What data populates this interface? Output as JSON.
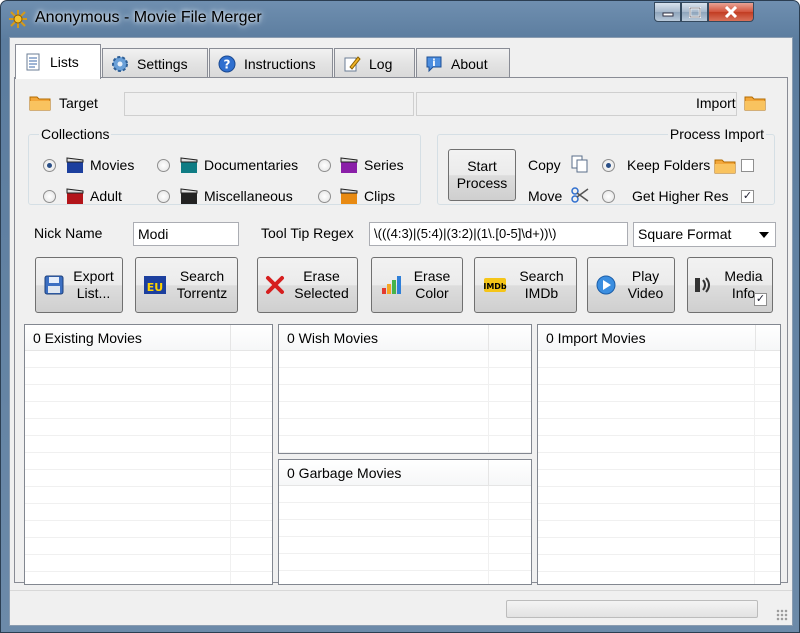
{
  "window": {
    "title": "Anonymous - Movie File Merger"
  },
  "tabs": [
    {
      "label": "Lists",
      "icon": "document-icon",
      "active": true
    },
    {
      "label": "Settings",
      "icon": "gear-icon",
      "active": false
    },
    {
      "label": "Instructions",
      "icon": "help-icon",
      "active": false
    },
    {
      "label": "Log",
      "icon": "pencil-note-icon",
      "active": false
    },
    {
      "label": "About",
      "icon": "info-icon",
      "active": false
    }
  ],
  "target": {
    "label": "Target",
    "value": ""
  },
  "import": {
    "label": "Import",
    "value": ""
  },
  "collections": {
    "title": "Collections",
    "options": [
      "Movies",
      "Documentaries",
      "Series",
      "Adult",
      "Miscellaneous",
      "Clips"
    ],
    "selected": "Movies"
  },
  "process_import": {
    "title": "Process Import",
    "start_button": "Start Process",
    "copy_label": "Copy",
    "move_label": "Move",
    "keep_folders_label": "Keep Folders",
    "keep_folders_checked": false,
    "higher_res_label": "Get Higher Res",
    "higher_res_checked": true,
    "mode_selected": "Copy"
  },
  "nick": {
    "label": "Nick Name",
    "value": "Modi"
  },
  "regex": {
    "label": "Tool Tip Regex",
    "value": "\\(((4:3)|(5:4)|(3:2)|(1\\.[0-5]\\d+))\\)"
  },
  "format_select": {
    "value": "Square Format"
  },
  "actions": [
    {
      "line1": "Export",
      "line2": "List..."
    },
    {
      "line1": "Search",
      "line2": "Torrentz"
    },
    {
      "line1": "Erase",
      "line2": "Selected"
    },
    {
      "line1": "Erase",
      "line2": "Color"
    },
    {
      "line1": "Search",
      "line2": "IMDb"
    },
    {
      "line1": "Play",
      "line2": "Video"
    },
    {
      "line1": "Media",
      "line2": "Info",
      "checked": true
    }
  ],
  "lists": {
    "existing": "0 Existing Movies",
    "wish": "0 Wish Movies",
    "garbage": "0 Garbage Movies",
    "import": "0 Import Movies"
  },
  "status": {
    "progress": 0
  },
  "colors": {
    "accent": "#2a4f87",
    "title_bar": "#6f8fb0",
    "close": "#c23c22"
  }
}
